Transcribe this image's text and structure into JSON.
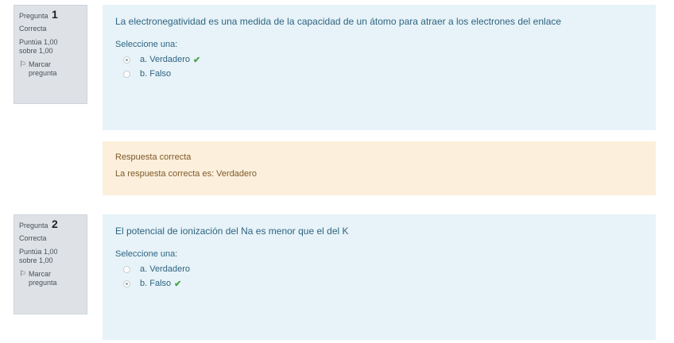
{
  "questions": [
    {
      "label": "Pregunta",
      "number": "1",
      "state": "Correcta",
      "grade_line1": "Puntúa 1,00",
      "grade_line2": "sobre 1,00",
      "flag_line1": "Marcar",
      "flag_line2": "pregunta",
      "text": "La electronegatividad es una medida de la capacidad de un átomo para atraer a los electrones del enlace",
      "prompt": "Seleccione una:",
      "options": [
        {
          "label": "a. Verdadero",
          "checked": true,
          "correct_mark": true
        },
        {
          "label": "b. Falso",
          "checked": false,
          "correct_mark": false
        }
      ],
      "feedback": {
        "result": "Respuesta correcta",
        "answer": "La respuesta correcta es: Verdadero"
      }
    },
    {
      "label": "Pregunta",
      "number": "2",
      "state": "Correcta",
      "grade_line1": "Puntúa 1,00",
      "grade_line2": "sobre 1,00",
      "flag_line1": "Marcar",
      "flag_line2": "pregunta",
      "text": "El potencial de ionización del Na es menor que el del K",
      "prompt": "Seleccione una:",
      "options": [
        {
          "label": "a. Verdadero",
          "checked": false,
          "correct_mark": false
        },
        {
          "label": "b. Falso",
          "checked": true,
          "correct_mark": true
        }
      ]
    }
  ],
  "icons": {
    "check": "✔",
    "flag": "⚐"
  },
  "colors": {
    "content_bg": "#e7f3f8",
    "feedback_bg": "#fcefdc",
    "info_bg": "#dee2e6",
    "correct": "#4aa34a"
  }
}
